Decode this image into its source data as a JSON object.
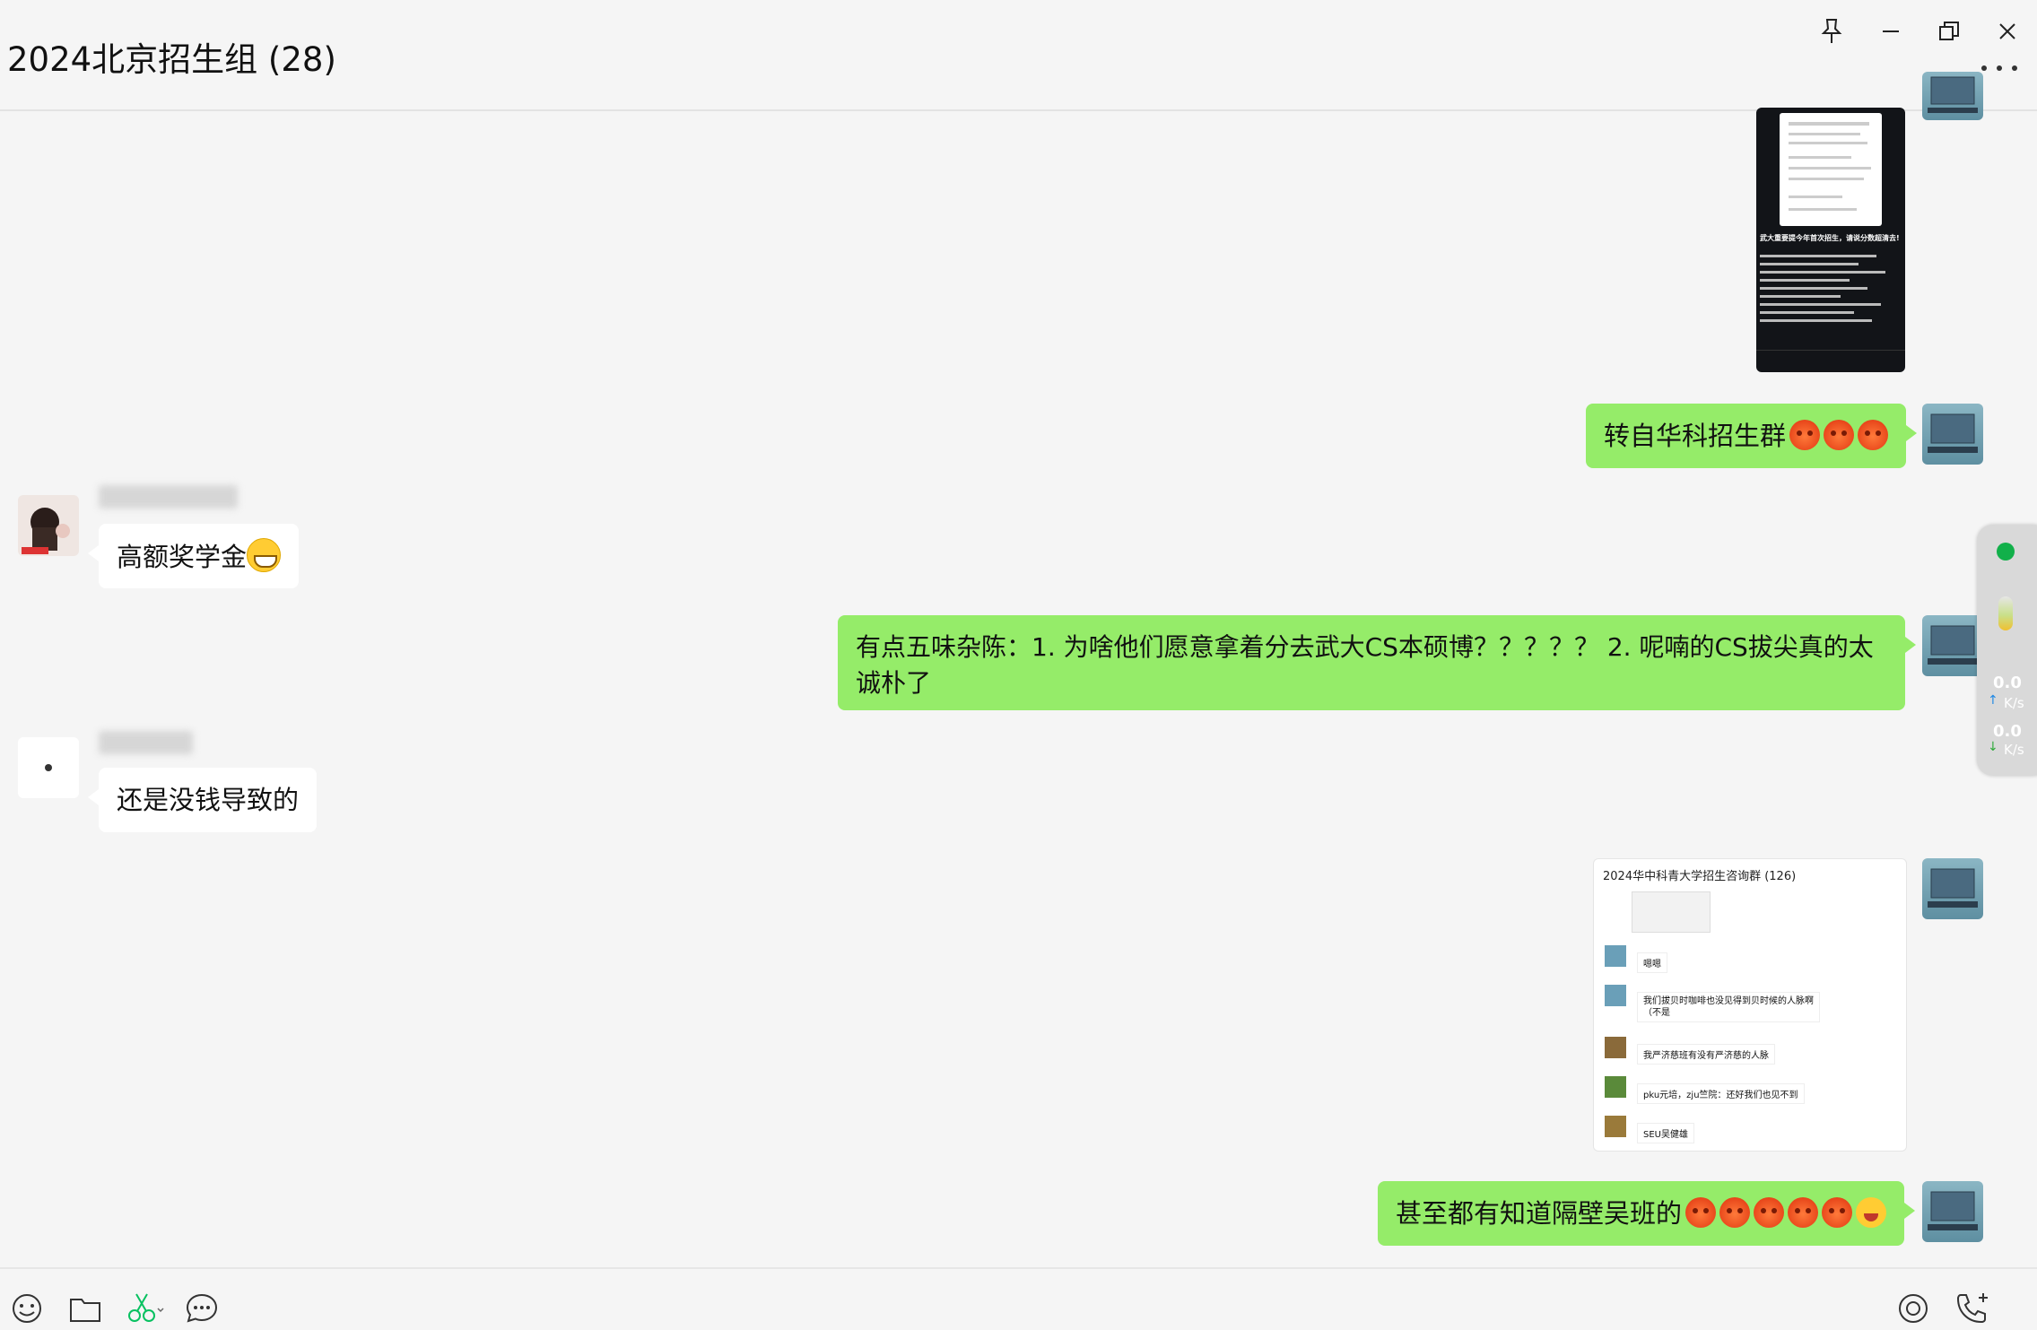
{
  "window": {
    "title": "2024北京招生组 (28)"
  },
  "messages": {
    "m2_text": "转自华科招生群",
    "m3_text": "高额奖学金",
    "m4_text": "有点五味杂陈：1. 为啥他们愿意拿着分去武大CS本硕博？？？？？ 2. 呢喃的CS拔尖真的太诚朴了",
    "m5_text": "还是没钱导致的",
    "m7_text": "甚至都有知道隔壁吴班的"
  },
  "shot1": {
    "caption": "武大重要提今年首次招生，请说分数超清去!"
  },
  "shot2": {
    "title": "2024华中科青大学招生咨询群 (126)",
    "rows": [
      "嗯嗯",
      "我们拔贝时咖啡也没见得到贝时候的人脉啊（不是",
      "我严济慈班有没有严济慈的人脉",
      "pku元培，zju竺院：还好我们也见不到",
      "SEU吴健雄"
    ]
  },
  "widget": {
    "up_value": "0.0",
    "up_unit": "K/s",
    "down_value": "0.0",
    "down_unit": "K/s"
  },
  "colors": {
    "bubble_me": "#95ec69",
    "bubble_other": "#ffffff",
    "background": "#f5f5f5",
    "accent": "#07c160"
  },
  "icons": {
    "pin": "pin-icon",
    "minimize": "minimize-icon",
    "restore": "restore-icon",
    "close": "close-icon",
    "more": "more-icon",
    "emoji": "emoji-icon",
    "folder": "folder-icon",
    "screenshot": "scissors-icon",
    "chat_history": "chat-bubble-icon",
    "live": "live-icon",
    "call": "phone-icon"
  }
}
